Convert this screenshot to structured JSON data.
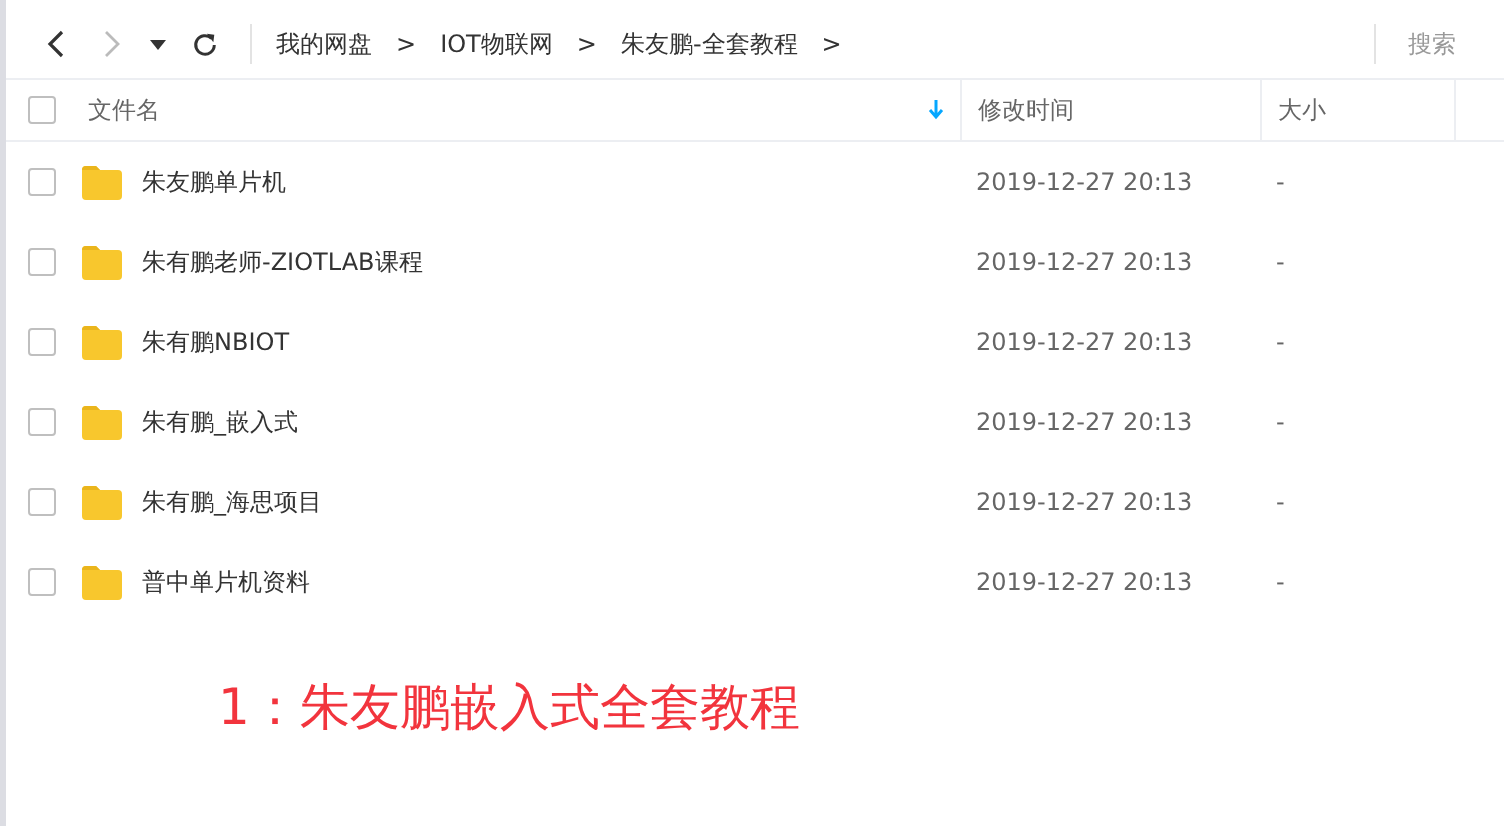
{
  "toolbar": {
    "breadcrumbs": [
      "我的网盘",
      "IOT物联网",
      "朱友鹏-全套教程"
    ],
    "separator": ">",
    "search": {
      "placeholder": "搜索"
    }
  },
  "table": {
    "columns": [
      "文件名",
      "修改时间",
      "大小"
    ],
    "select_all": {
      "checked": false
    },
    "rows": [
      {
        "name": "朱友鹏单片机",
        "modified": "2019-12-27 20:13",
        "size": "-",
        "checked": false
      },
      {
        "name": "朱有鹏老师-ZIOTLAB课程",
        "modified": "2019-12-27 20:13",
        "size": "-",
        "checked": false
      },
      {
        "name": "朱有鹏NBIOT",
        "modified": "2019-12-27 20:13",
        "size": "-",
        "checked": false
      },
      {
        "name": "朱有鹏_嵌入式",
        "modified": "2019-12-27 20:13",
        "size": "-",
        "checked": false
      },
      {
        "name": "朱有鹏_海思项目",
        "modified": "2019-12-27 20:13",
        "size": "-",
        "checked": false
      },
      {
        "name": "普中单片机资料",
        "modified": "2019-12-27 20:13",
        "size": "-",
        "checked": false
      }
    ]
  },
  "annotation": "1：朱友鹏嵌入式全套教程"
}
